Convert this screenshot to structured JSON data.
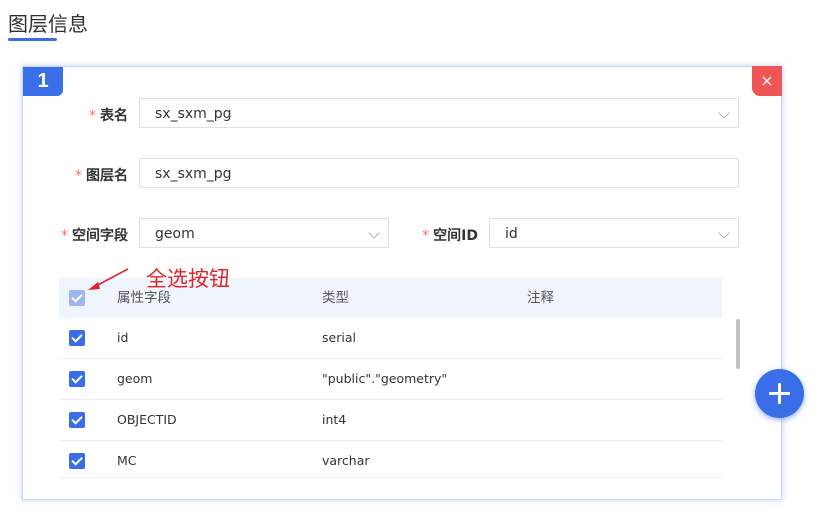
{
  "page": {
    "title": "图层信息"
  },
  "card": {
    "index": "1",
    "close_icon": "×"
  },
  "form": {
    "table_name": {
      "required": "*",
      "label": "表名",
      "value": "sx_sxm_pg"
    },
    "layer_name": {
      "required": "*",
      "label": "图层名",
      "value": "sx_sxm_pg"
    },
    "spatial_field": {
      "required": "*",
      "label": "空间字段",
      "value": "geom"
    },
    "spatial_id": {
      "required": "*",
      "label": "空间ID",
      "value": "id"
    }
  },
  "table": {
    "headers": [
      "属性字段",
      "类型",
      "注释"
    ],
    "rows": [
      {
        "field": "id",
        "type": "serial",
        "comment": ""
      },
      {
        "field": "geom",
        "type": "\"public\".\"geometry\"",
        "comment": ""
      },
      {
        "field": "OBJECTID",
        "type": "int4",
        "comment": ""
      },
      {
        "field": "MC",
        "type": "varchar",
        "comment": ""
      }
    ]
  },
  "annotation": {
    "text": "全选按钮",
    "color": "#e0242a"
  },
  "colors": {
    "primary": "#3a6ee8",
    "danger": "#f05454"
  }
}
